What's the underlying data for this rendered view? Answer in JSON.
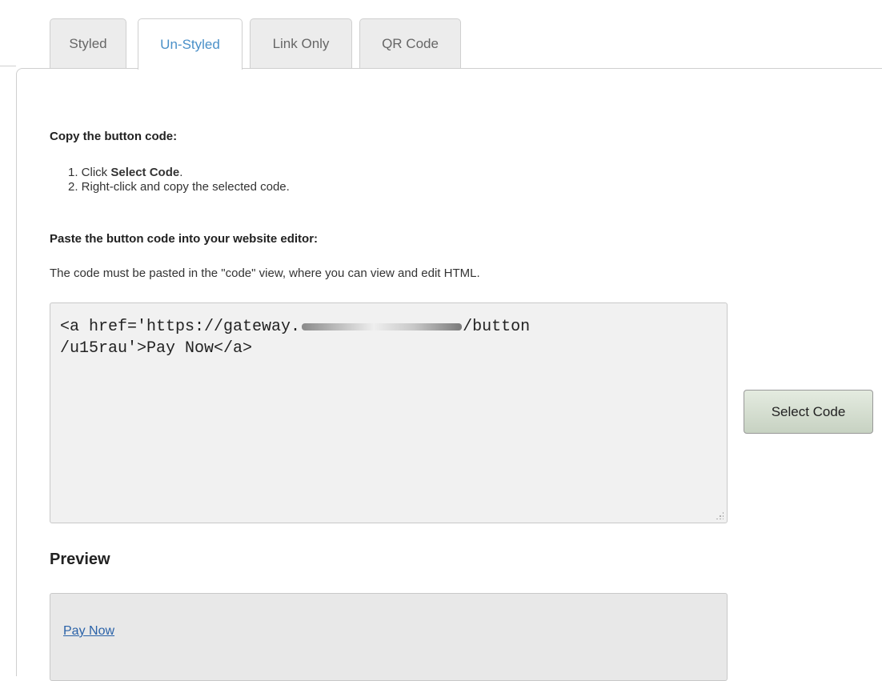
{
  "tabs": [
    {
      "label": "Styled",
      "active": false
    },
    {
      "label": "Un-Styled",
      "active": true
    },
    {
      "label": "Link Only",
      "active": false
    },
    {
      "label": "QR Code",
      "active": false
    }
  ],
  "copy_heading": "Copy the button code:",
  "steps": {
    "step1_prefix": "1. Click ",
    "step1_bold": "Select Code",
    "step1_suffix": ".",
    "step2": "2. Right-click and copy the selected code."
  },
  "paste_heading": "Paste the button code into your website editor:",
  "paste_note": "The code must be pasted in the \"code\" view, where you can view and edit HTML.",
  "code": {
    "line1_prefix": "<a href='https://gateway.",
    "line1_suffix": "/button",
    "line2": "/u15rau'>Pay Now</a>"
  },
  "select_code_button": "Select Code",
  "preview": {
    "title": "Preview",
    "link_text": "Pay Now"
  },
  "colors": {
    "active_tab_text": "#4a90c8",
    "link": "#2a62a8"
  }
}
